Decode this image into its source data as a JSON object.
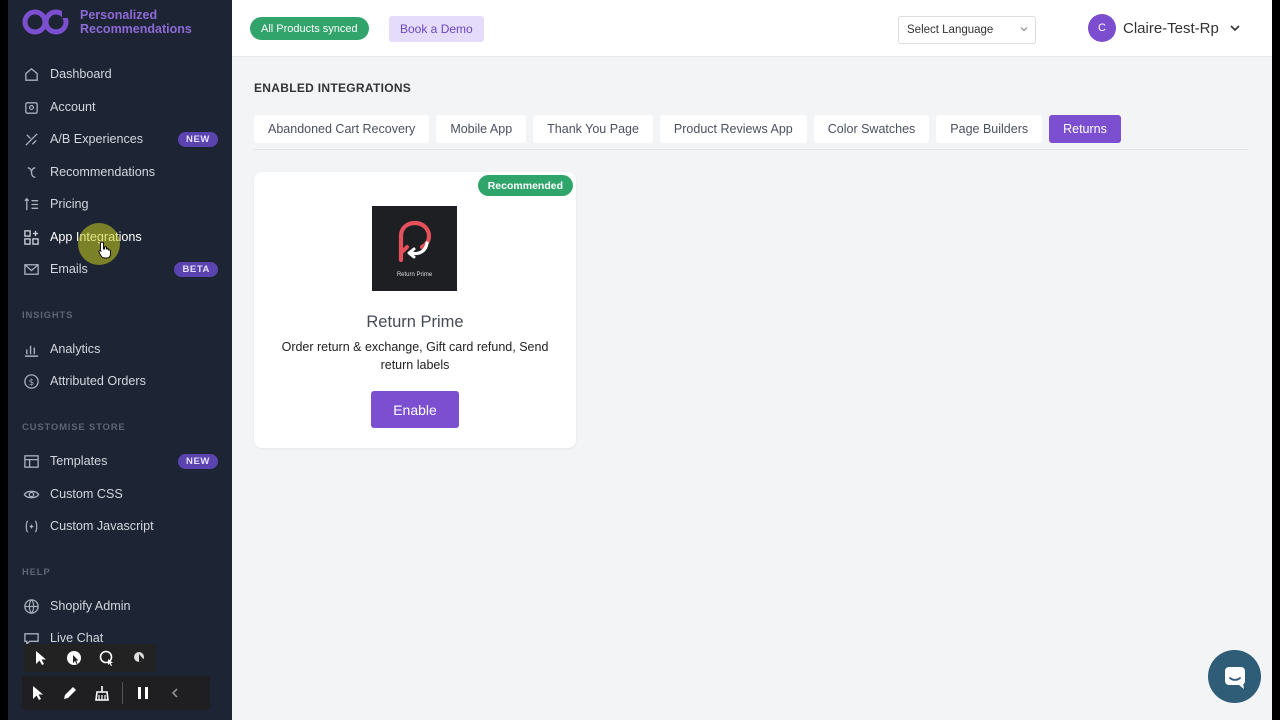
{
  "brand": {
    "line1": "Personalized",
    "line2": "Recommendations"
  },
  "sidebar": {
    "items": [
      {
        "label": "Dashboard",
        "icon": "dashboard-icon"
      },
      {
        "label": "Account",
        "icon": "account-icon"
      },
      {
        "label": "A/B Experiences",
        "icon": "experiment-icon",
        "badge": "NEW"
      },
      {
        "label": "Recommendations",
        "icon": "recommendations-icon"
      },
      {
        "label": "Pricing",
        "icon": "pricing-icon"
      },
      {
        "label": "App Integrations",
        "icon": "integrations-icon",
        "active": true
      },
      {
        "label": "Emails",
        "icon": "mail-icon",
        "badge": "BETA"
      }
    ],
    "sections": {
      "insights": "INSIGHTS",
      "customise": "CUSTOMISE STORE",
      "help": "HELP"
    },
    "insights_items": [
      {
        "label": "Analytics",
        "icon": "analytics-icon"
      },
      {
        "label": "Attributed Orders",
        "icon": "dollar-icon"
      }
    ],
    "customise_items": [
      {
        "label": "Templates",
        "icon": "templates-icon",
        "badge": "NEW"
      },
      {
        "label": "Custom CSS",
        "icon": "eye-icon"
      },
      {
        "label": "Custom Javascript",
        "icon": "code-icon"
      }
    ],
    "help_items": [
      {
        "label": "Shopify Admin",
        "icon": "globe-icon"
      },
      {
        "label": "Live Chat",
        "icon": "chat-icon"
      }
    ]
  },
  "header": {
    "sync_status": "All Products synced",
    "demo_label": "Book a Demo",
    "language_placeholder": "Select Language",
    "user_initial": "C",
    "user_name": "Claire-Test-Rp"
  },
  "main": {
    "title": "ENABLED INTEGRATIONS",
    "tabs": [
      "Abandoned Cart Recovery",
      "Mobile App",
      "Thank You Page",
      "Product Reviews App",
      "Color Swatches",
      "Page Builders",
      "Returns"
    ],
    "active_tab": "Returns",
    "card": {
      "badge": "Recommended",
      "logo_caption": "Return Prime",
      "title": "Return Prime",
      "description": "Order return & exchange, Gift card refund, Send return labels",
      "button": "Enable"
    }
  },
  "colors": {
    "accent": "#7b4fd0",
    "sidebar_bg": "#1d2433",
    "success": "#2fa56c"
  }
}
